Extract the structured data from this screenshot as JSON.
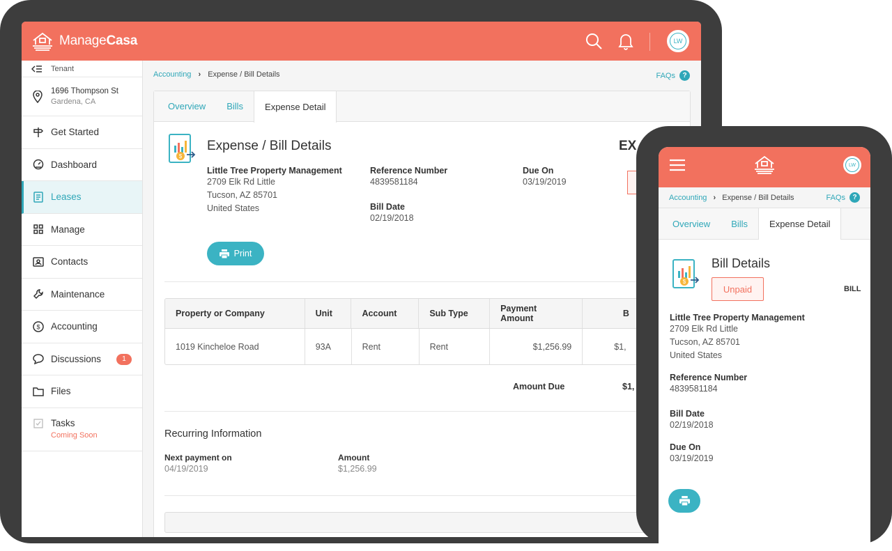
{
  "app": {
    "logo_light": "Manage",
    "logo_bold": "Casa",
    "avatar": "LW"
  },
  "colors": {
    "brand": "#f2715e",
    "accent": "#3bb3c3",
    "link": "#2fa7b8"
  },
  "sidebar": {
    "tenant_label": "Tenant",
    "address_line1": "1696 Thompson St",
    "address_line2": "Gardena, CA",
    "items": [
      {
        "label": "Get Started",
        "icon": "signpost-icon"
      },
      {
        "label": "Dashboard",
        "icon": "gauge-icon"
      },
      {
        "label": "Leases",
        "icon": "document-icon"
      },
      {
        "label": "Manage",
        "icon": "grid-icon"
      },
      {
        "label": "Contacts",
        "icon": "contact-card-icon"
      },
      {
        "label": "Maintenance",
        "icon": "wrench-icon"
      },
      {
        "label": "Accounting",
        "icon": "dollar-icon"
      },
      {
        "label": "Discussions",
        "icon": "chat-icon",
        "badge": "1"
      },
      {
        "label": "Files",
        "icon": "folder-icon"
      },
      {
        "label": "Tasks",
        "icon": "checkbox-icon",
        "sub": "Coming Soon"
      }
    ]
  },
  "breadcrumb": {
    "link": "Accounting",
    "sep": "›",
    "current": "Expense / Bill Details",
    "faq": "FAQs",
    "faq_icon": "?"
  },
  "tabs": [
    "Overview",
    "Bills",
    "Expense Detail"
  ],
  "detail": {
    "title": "Expense / Bill Details",
    "right_title_partial": "EX",
    "company": "Little Tree Property Management",
    "addr1": "2709 Elk Rd Little",
    "addr2": "Tucson, AZ 85701",
    "addr3": "United States",
    "ref_label": "Reference Number",
    "ref_value": "4839581184",
    "due_label": "Due On",
    "due_value": "03/19/2019",
    "bill_date_label": "Bill Date",
    "bill_date_value": "02/19/2018",
    "print": "Print"
  },
  "table": {
    "headers": [
      "Property or Company",
      "Unit",
      "Account",
      "Sub Type",
      "Payment Amount",
      "B"
    ],
    "row": [
      "1019 Kincheloe Road",
      "93A",
      "Rent",
      "Rent",
      "$1,256.99",
      "$1,"
    ]
  },
  "amount_due": {
    "label": "Amount Due",
    "value": "$1,"
  },
  "recurring": {
    "title": "Recurring Information",
    "next_label": "Next payment on",
    "next_value": "04/19/2019",
    "amount_label": "Amount",
    "amount_value": "$1,256.99"
  },
  "mobile": {
    "avatar": "LW",
    "breadcrumb_link": "Accounting",
    "breadcrumb_current": "Expense / Bill Details",
    "faq": "FAQs",
    "tabs": [
      "Overview",
      "Bills",
      "Expense Detail"
    ],
    "title": "Bill Details",
    "status": "Unpaid",
    "bill_partial": "BILL",
    "company": "Little Tree Property Management",
    "addr1": "2709 Elk Rd Little",
    "addr2": "Tucson, AZ 85701",
    "addr3": "United States",
    "ref_label": "Reference Number",
    "ref_value": "4839581184",
    "bill_date_label": "Bill Date",
    "bill_date_value": "02/19/2018",
    "due_label": "Due On",
    "due_value": "03/19/2019"
  }
}
